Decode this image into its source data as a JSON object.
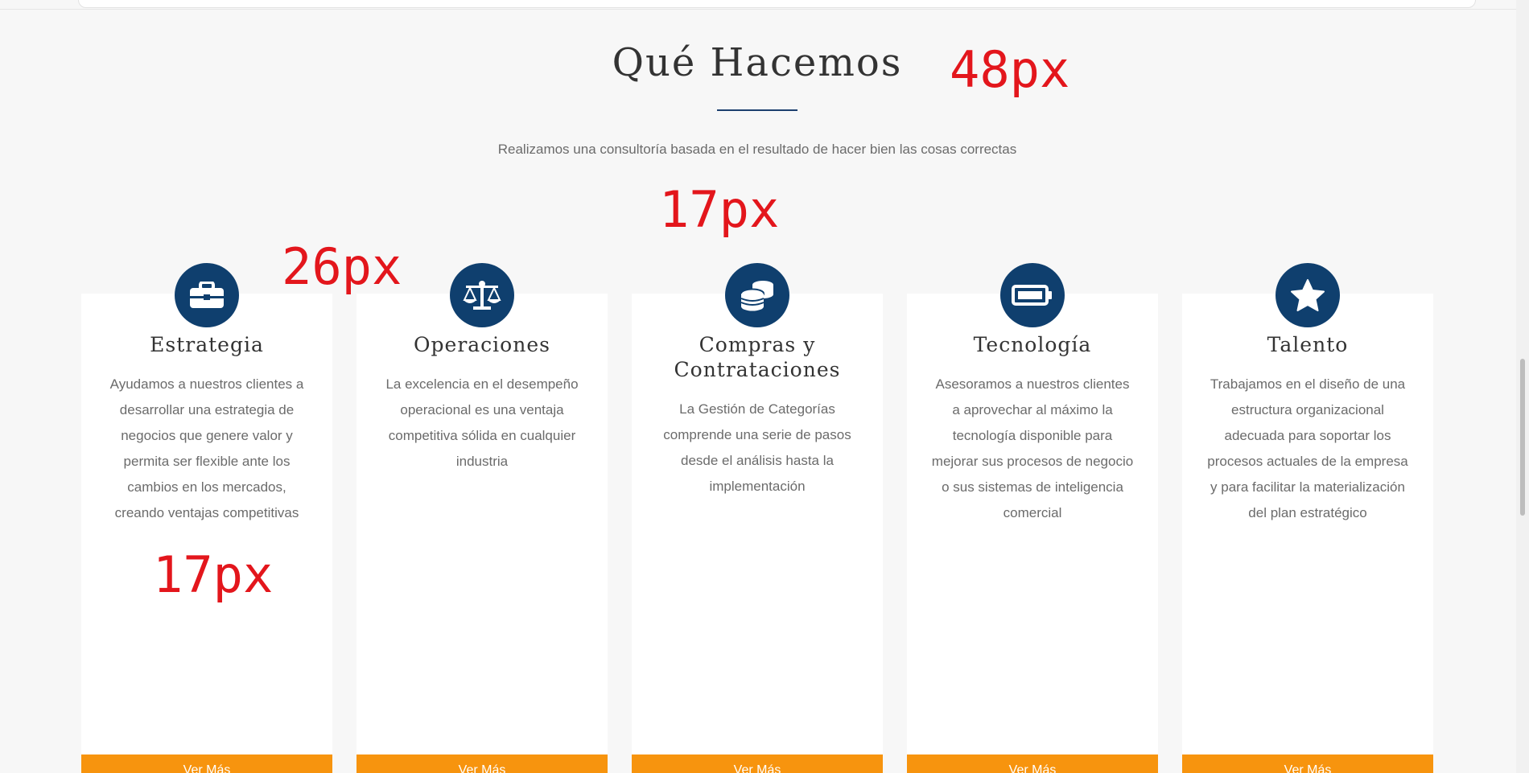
{
  "section": {
    "title": "Qué Hacemos",
    "subtitle": "Realizamos una consultoría basada en el resultado de hacer bien las cosas correctas"
  },
  "annotations": {
    "title_size": "48px",
    "subtitle_size": "17px",
    "card_title_size": "26px",
    "card_text_size": "17px"
  },
  "cards": [
    {
      "icon": "briefcase-icon",
      "title": "Estrategia",
      "text": "Ayudamos a nuestros clientes a desarrollar una estrategia de negocios que genere valor y permita ser flexible ante los cambios en los mercados, creando ventajas competitivas",
      "button": "Ver Más"
    },
    {
      "icon": "balance-scale-icon",
      "title": "Operaciones",
      "text": "La excelencia en el desempeño operacional es una ventaja competitiva sólida en cualquier industria",
      "button": "Ver Más"
    },
    {
      "icon": "coins-icon",
      "title": "Compras y Contrataciones",
      "text": "La Gestión de Categorías comprende una serie de pasos desde el análisis hasta la implementación",
      "button": "Ver Más"
    },
    {
      "icon": "battery-icon",
      "title": "Tecnología",
      "text": "Asesoramos a nuestros clientes a aprovechar al máximo la tecnología disponible para mejorar sus procesos de negocio o sus sistemas de inteligencia comercial",
      "button": "Ver Más"
    },
    {
      "icon": "star-icon",
      "title": "Talento",
      "text": "Trabajamos en el diseño de una estructura organizacional adecuada para soportar los procesos actuales de la empresa y para facilitar la materialización del plan estratégico",
      "button": "Ver Más"
    }
  ],
  "colors": {
    "background": "#f7f7f7",
    "icon_circle": "#0f3f6e",
    "button": "#f7940e",
    "annotation": "#e3161c",
    "underline": "#1c3f6e"
  }
}
